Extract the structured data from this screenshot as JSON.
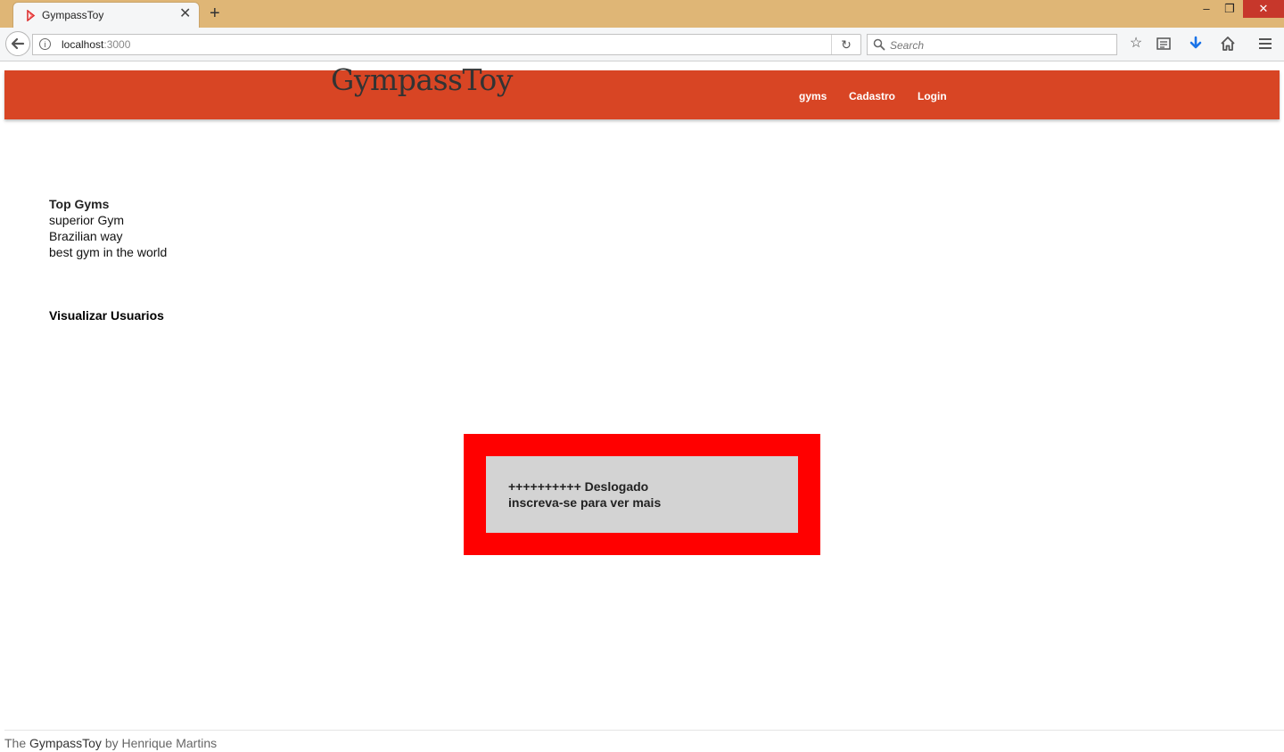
{
  "browser": {
    "tab_title": "GympassToy",
    "tab_close": "✕",
    "new_tab": "+",
    "url_host": "localhost",
    "url_port": ":3000",
    "search_placeholder": "Search",
    "window_controls": {
      "minimize": "–",
      "restore": "❐",
      "close": "✕"
    },
    "icons": [
      "back-arrow-icon",
      "info-icon",
      "reload-icon",
      "search-icon",
      "bookmark-star-icon",
      "reading-list-icon",
      "downloads-icon",
      "home-icon",
      "menu-icon"
    ]
  },
  "header": {
    "brand": "GympassToy",
    "background": "#d84524",
    "nav": [
      {
        "label": "gyms"
      },
      {
        "label": "Cadastro"
      },
      {
        "label": "Login"
      }
    ]
  },
  "top_gyms": {
    "heading": "Top Gyms",
    "items": [
      "superior Gym",
      "Brazilian way",
      "best gym in the world"
    ]
  },
  "view_users": "Visualizar Usuarios",
  "alert": {
    "line1": "++++++++++ Deslogado",
    "line2": "inscreva-se para ver mais",
    "border_color": "#ff0000",
    "fill_color": "#d3d3d3"
  },
  "footer": {
    "prefix": "The",
    "brand": "GympassToy",
    "suffix": "by Henrique Martins"
  }
}
